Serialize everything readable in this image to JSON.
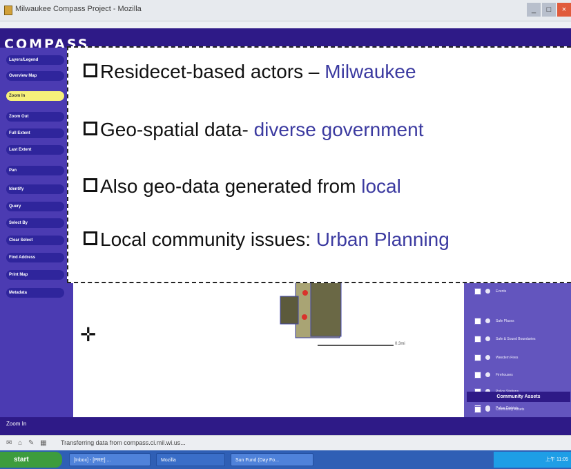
{
  "window": {
    "title": "Milwaukee Compass Project - Mozilla"
  },
  "app": {
    "logo": "COMPASS"
  },
  "sidebar": {
    "items": [
      {
        "label": "Layers/Legend"
      },
      {
        "label": "Overview Map"
      },
      {
        "label": "Zoom In"
      },
      {
        "label": "Zoom Out"
      },
      {
        "label": "Full Extent"
      },
      {
        "label": "Last Extent"
      },
      {
        "label": "Pan"
      },
      {
        "label": "Identify"
      },
      {
        "label": "Query"
      },
      {
        "label": "Select By"
      },
      {
        "label": "Clear Select"
      },
      {
        "label": "Find Address"
      },
      {
        "label": "Print Map"
      },
      {
        "label": "Metadata"
      }
    ]
  },
  "overlay": {
    "bullets": [
      {
        "text": "Residecet-based actors – ",
        "highlight": "Milwaukee"
      },
      {
        "text": "Geo-spatial data- ",
        "highlight": "diverse government"
      },
      {
        "text": "Also geo-data generated from ",
        "highlight": "local"
      },
      {
        "text": "Local community issues: ",
        "highlight": "Urban Planning"
      }
    ]
  },
  "legend": {
    "items": [
      {
        "label": "Events"
      },
      {
        "label": "Safe Places"
      },
      {
        "label": "Safe & Sound Boundaries"
      },
      {
        "label": "Weedem Fires"
      },
      {
        "label": "Firehouses"
      },
      {
        "label": "Police Stations"
      },
      {
        "label": "Police Districts"
      }
    ],
    "section_title": "Community Assets",
    "section_item": "Community Assets"
  },
  "map": {
    "scale_label": "0.3mi"
  },
  "status": {
    "tool_label": "Zoom In",
    "message": "Transferring data from compass.ci.mil.wi.us..."
  },
  "taskbar": {
    "start_label": "start",
    "tasks": [
      "[Inbox] - [PRE] ...",
      "Mozilla",
      "Sun Fund (Day Fo..."
    ],
    "tray_time": "上午 11:05"
  },
  "colors": {
    "purple_dark": "#2e1a87",
    "purple_mid": "#4b3bb2",
    "highlight_text": "#3b3aa0"
  }
}
